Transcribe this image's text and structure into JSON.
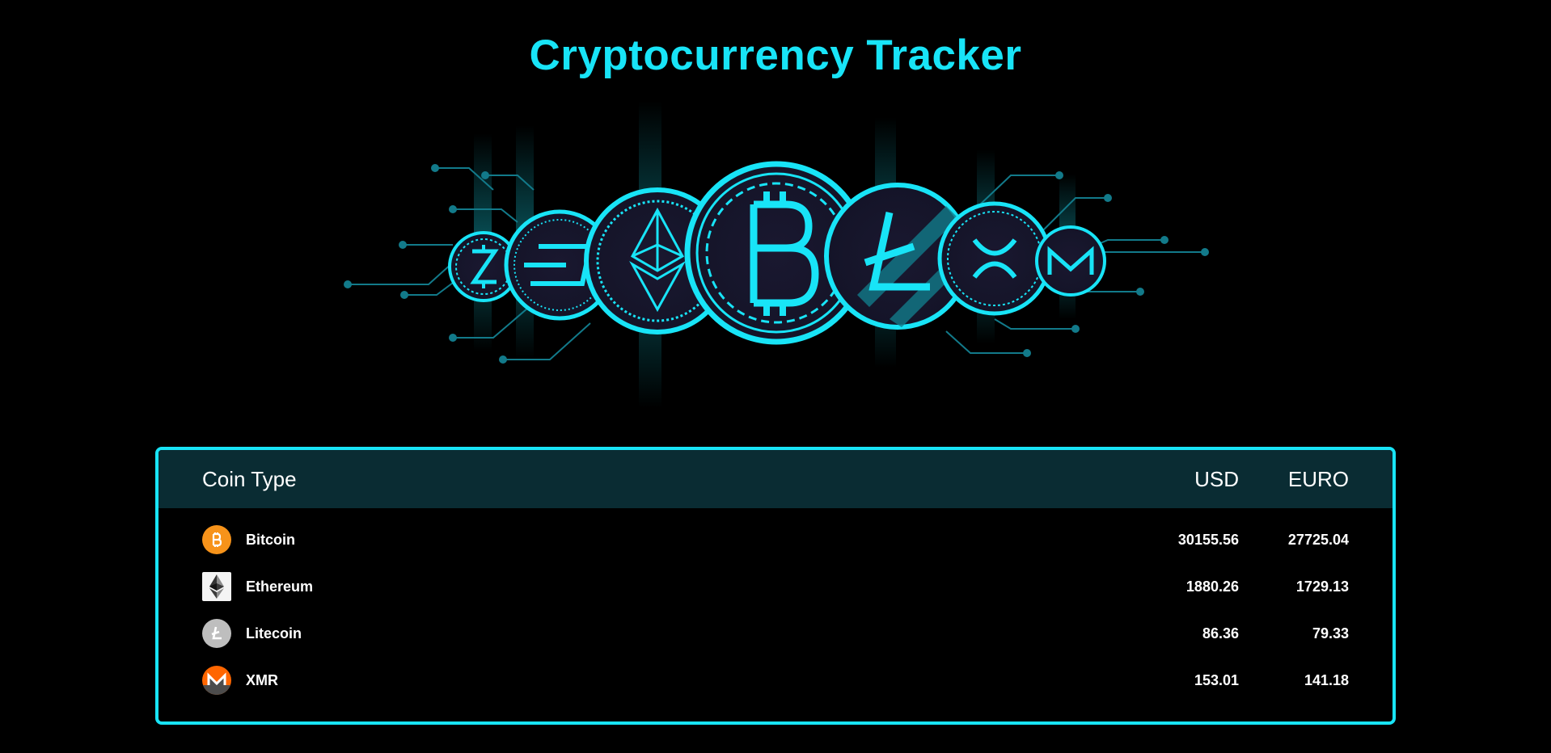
{
  "header": {
    "title": "Cryptocurrency Tracker"
  },
  "hero": {
    "image": "crypto-coins-circuit-banner",
    "coins": [
      "zcash-icon",
      "dash-icon",
      "ethereum-icon",
      "bitcoin-icon",
      "litecoin-icon",
      "ripple-icon",
      "monero-icon"
    ]
  },
  "table": {
    "columns": {
      "coin": "Coin Type",
      "usd": "USD",
      "euro": "EURO"
    },
    "rows": [
      {
        "icon": "bitcoin-icon",
        "name": "Bitcoin",
        "usd": "30155.56",
        "euro": "27725.04"
      },
      {
        "icon": "ethereum-icon",
        "name": "Ethereum",
        "usd": "1880.26",
        "euro": "1729.13"
      },
      {
        "icon": "litecoin-icon",
        "name": "Litecoin",
        "usd": "86.36",
        "euro": "79.33"
      },
      {
        "icon": "monero-icon",
        "name": "XMR",
        "usd": "153.01",
        "euro": "141.18"
      }
    ]
  },
  "colors": {
    "accent": "#18e4f7",
    "background": "#000000",
    "table_header_bg": "#0a2c33",
    "bitcoin": "#f7931a",
    "monero": "#ff6600",
    "litecoin": "#bebebe"
  }
}
